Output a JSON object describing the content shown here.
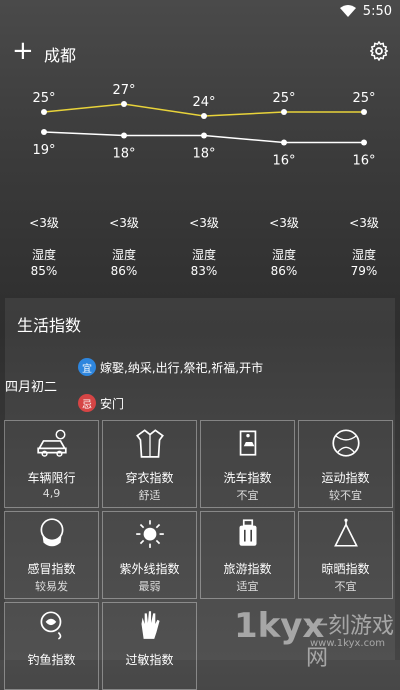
{
  "status": {
    "time": "5:50"
  },
  "header": {
    "city": "成都"
  },
  "forecast": {
    "highs": [
      "25°",
      "27°",
      "24°",
      "25°",
      "25°"
    ],
    "lows": [
      "19°",
      "18°",
      "18°",
      "16°",
      "16°"
    ],
    "high_values": [
      25,
      27,
      24,
      25,
      25
    ],
    "low_values": [
      19,
      18,
      18,
      16,
      16
    ],
    "winds": [
      "<3级",
      "<3级",
      "<3级",
      "<3级",
      "<3级"
    ],
    "humidity_label": "湿度",
    "humidity": [
      "85%",
      "86%",
      "83%",
      "86%",
      "79%"
    ],
    "colors": {
      "high_line": "#e8d33a",
      "low_line": "#ffffff"
    }
  },
  "life": {
    "title": "生活指数",
    "lunar_date": "四月初二",
    "yi_badge": "宜",
    "yi_text": "嫁娶,纳采,出行,祭祀,祈福,开市",
    "ji_badge": "忌",
    "ji_text": "安门",
    "tiles": [
      {
        "name": "车辆限行",
        "value": "4,9",
        "icon": "car-icon"
      },
      {
        "name": "穿衣指数",
        "value": "舒适",
        "icon": "jacket-icon"
      },
      {
        "name": "洗车指数",
        "value": "不宜",
        "icon": "car-wash-icon"
      },
      {
        "name": "运动指数",
        "value": "较不宜",
        "icon": "ball-icon"
      },
      {
        "name": "感冒指数",
        "value": "较易发",
        "icon": "mask-icon"
      },
      {
        "name": "紫外线指数",
        "value": "最弱",
        "icon": "sun-icon"
      },
      {
        "name": "旅游指数",
        "value": "适宜",
        "icon": "luggage-icon"
      },
      {
        "name": "晾晒指数",
        "value": "不宜",
        "icon": "hanger-icon"
      },
      {
        "name": "钓鱼指数",
        "value": "",
        "icon": "fishing-icon"
      },
      {
        "name": "过敏指数",
        "value": "",
        "icon": "hand-icon"
      }
    ]
  },
  "watermark": {
    "logo": "1kyx",
    "cn": "一刻游戏网",
    "url": "www.1kyx.com"
  }
}
